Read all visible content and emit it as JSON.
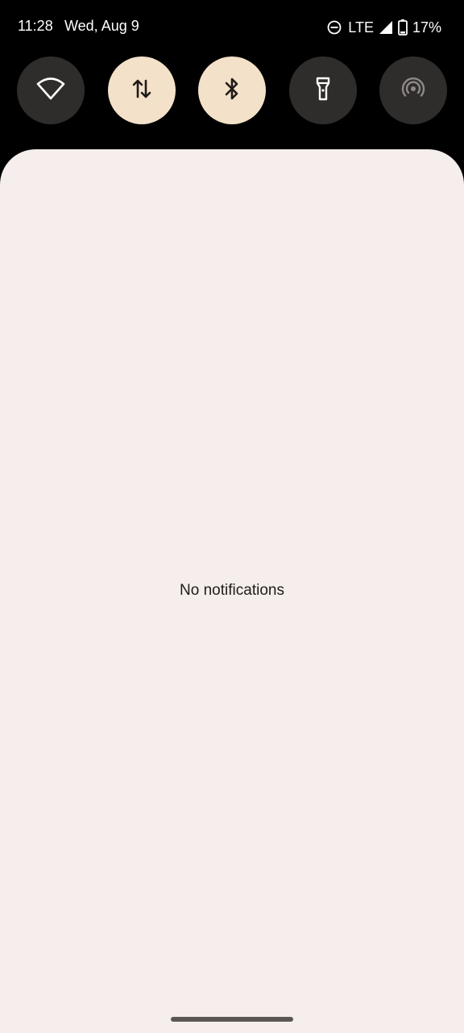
{
  "status_bar": {
    "time": "11:28",
    "date": "Wed, Aug 9",
    "network": "LTE",
    "battery": "17%",
    "icons": [
      "do-not-disturb-icon",
      "signal-icon",
      "battery-icon"
    ]
  },
  "quick_tiles": [
    {
      "name": "wifi",
      "icon": "wifi-icon",
      "state": "off"
    },
    {
      "name": "mobile-data",
      "icon": "data-transfer-icon",
      "state": "on"
    },
    {
      "name": "bluetooth",
      "icon": "bluetooth-icon",
      "state": "on"
    },
    {
      "name": "flashlight",
      "icon": "flashlight-icon",
      "state": "off"
    },
    {
      "name": "hotspot",
      "icon": "hotspot-icon",
      "state": "off"
    }
  ],
  "shade": {
    "empty_message": "No notifications"
  },
  "colors": {
    "background": "#000000",
    "tile_off": "#2f2d2b",
    "tile_on": "#f3e1c9",
    "shade": "#f5eeec"
  }
}
